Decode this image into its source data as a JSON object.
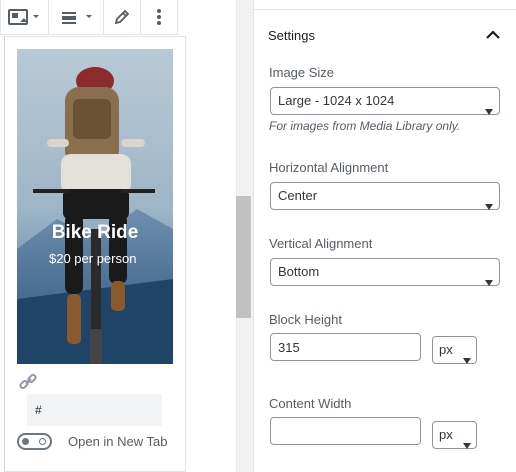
{
  "block_toolbar": {
    "icons": [
      "cover-image-icon",
      "align-icon",
      "pencil-icon",
      "more-vertical-icon"
    ]
  },
  "cover": {
    "title": "Bike Ride",
    "subtitle": "$20 per person"
  },
  "link": {
    "url_value": "#",
    "open_new_tab_label": "Open in New Tab"
  },
  "settings": {
    "title": "Settings",
    "image_size": {
      "label": "Image Size",
      "value": "Large - 1024 x 1024",
      "help": "For images from Media Library only."
    },
    "horizontal_alignment": {
      "label": "Horizontal Alignment",
      "value": "Center"
    },
    "vertical_alignment": {
      "label": "Vertical Alignment",
      "value": "Bottom"
    },
    "block_height": {
      "label": "Block Height",
      "value": "315",
      "unit": "px"
    },
    "content_width": {
      "label": "Content Width",
      "value": "",
      "unit": "px"
    }
  }
}
